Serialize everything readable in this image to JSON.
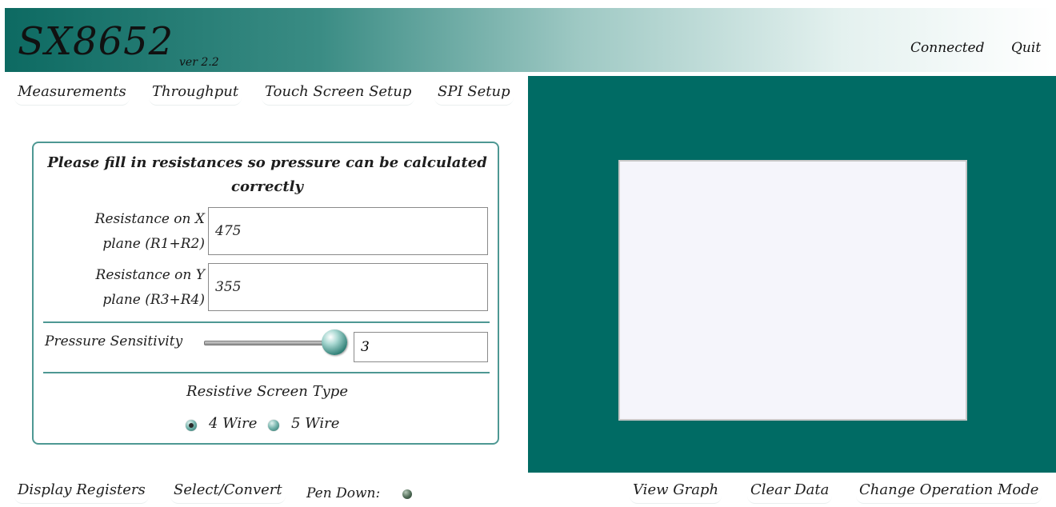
{
  "header": {
    "title": "SX8652",
    "version": "ver 2.2",
    "connected_label": "Connected",
    "quit_label": "Quit"
  },
  "nav": {
    "measurements": "Measurements",
    "throughput": "Throughput",
    "touch_screen_setup": "Touch Screen Setup",
    "spi_setup": "SPI Setup"
  },
  "form": {
    "heading_line1": "Please fill in resistances so pressure can be calculated",
    "heading_line2": "correctly",
    "res_x_label_line1": "Resistance on X",
    "res_x_label_line2": "plane (R1+R2)",
    "res_x_value": "475",
    "res_y_label_line1": "Resistance on Y",
    "res_y_label_line2": "plane (R3+R4)",
    "res_y_value": "355",
    "pressure_label": "Pressure Sensitivity",
    "pressure_value": "3",
    "screen_type_label": "Resistive Screen Type",
    "wire4_label": "4 Wire",
    "wire5_label": "5 Wire",
    "selected_wire": "4 Wire"
  },
  "footer": {
    "display_registers": "Display Registers",
    "select_convert": "Select/Convert",
    "pen_down_label": "Pen Down:",
    "view_graph": "View Graph",
    "clear_data": "Clear Data",
    "change_operation_mode": "Change Operation Mode"
  },
  "colors": {
    "accent_teal": "#006b64",
    "border_teal": "#4e9893",
    "canvas_bg": "#f5f5fb"
  }
}
